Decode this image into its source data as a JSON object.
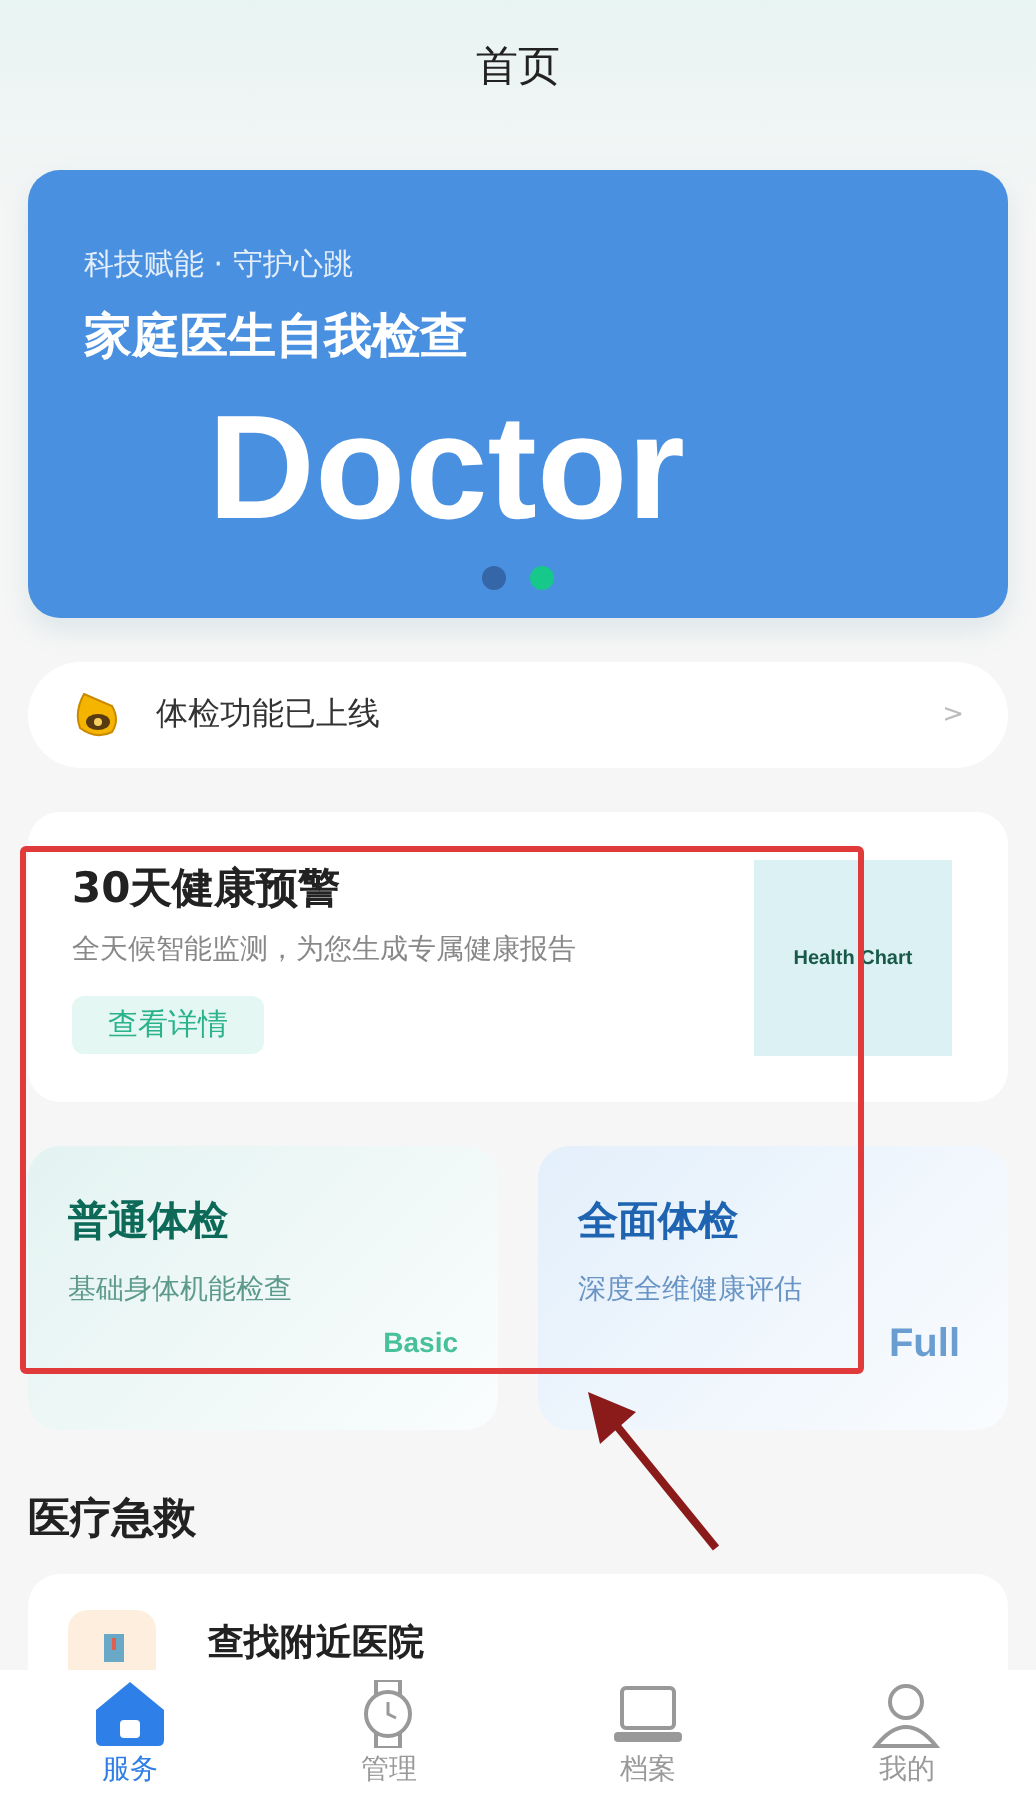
{
  "header": {
    "title": "首页"
  },
  "banner": {
    "subtitle": "科技赋能 · 守护心跳",
    "title": "家庭医生自我检查",
    "overlay_text": "Doctor",
    "dots": [
      {
        "selected": false
      },
      {
        "selected": true
      }
    ]
  },
  "notice": {
    "text": "体检功能已上线",
    "chevron": ">"
  },
  "alert_card": {
    "title": "30天健康预警",
    "description": "全天候智能监测，为您生成专属健康报告",
    "button": "查看详情",
    "chart_label": "Health Chart"
  },
  "exam_cards": [
    {
      "kind": "basic",
      "title": "普通体检",
      "description": "基础身体机能检查",
      "tag": "Basic"
    },
    {
      "kind": "full",
      "title": "全面体检",
      "description": "深度全维健康评估",
      "tag": "Full"
    }
  ],
  "section": {
    "title": "医疗急救",
    "items": [
      {
        "title": "查找附近医院"
      }
    ]
  },
  "tab_bar": [
    {
      "label": "服务",
      "kind": "home",
      "selected": true
    },
    {
      "label": "管理",
      "kind": "watch",
      "selected": false
    },
    {
      "label": "档案",
      "kind": "laptop",
      "selected": false
    },
    {
      "label": "我的",
      "kind": "user",
      "selected": false
    }
  ]
}
